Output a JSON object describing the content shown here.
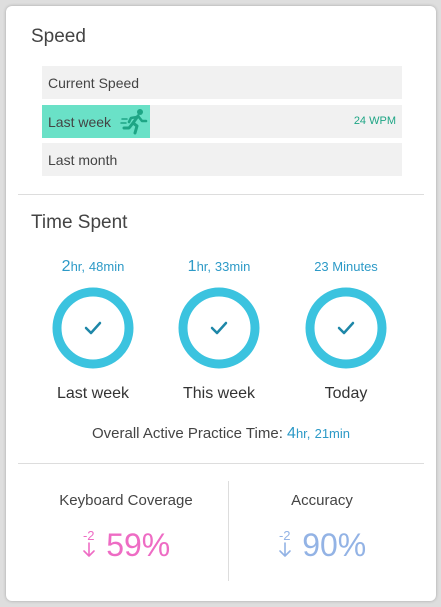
{
  "speed": {
    "title": "Speed",
    "rows": [
      {
        "label": "Current Speed",
        "wpm": "",
        "progress": 0
      },
      {
        "label": "Last week",
        "wpm": "24 WPM",
        "progress": 0.3
      },
      {
        "label": "Last month",
        "wpm": "",
        "progress": 0
      }
    ],
    "fill_color": "#6ae1c7",
    "runner_icon": "running-person-icon"
  },
  "time_spent": {
    "title": "Time Spent",
    "items": [
      {
        "hours": "2",
        "hr_unit": "hr,",
        "minutes": "48min",
        "label": "Last week"
      },
      {
        "hours": "1",
        "hr_unit": "hr,",
        "minutes": "33min",
        "label": "This week"
      },
      {
        "text": "23 Minutes",
        "label": "Today"
      }
    ],
    "ring_color": "#3bc3df",
    "check_color": "#1e87a8",
    "overall": {
      "label": "Overall Active Practice Time:",
      "hours": "4",
      "hr_unit": "hr,",
      "minutes": "21min"
    }
  },
  "stats": {
    "keyboard_coverage": {
      "title": "Keyboard Coverage",
      "delta": "-2",
      "value": "59%",
      "color": "#ee6cc4"
    },
    "accuracy": {
      "title": "Accuracy",
      "delta": "-2",
      "value": "90%",
      "color": "#93b3e5"
    }
  }
}
